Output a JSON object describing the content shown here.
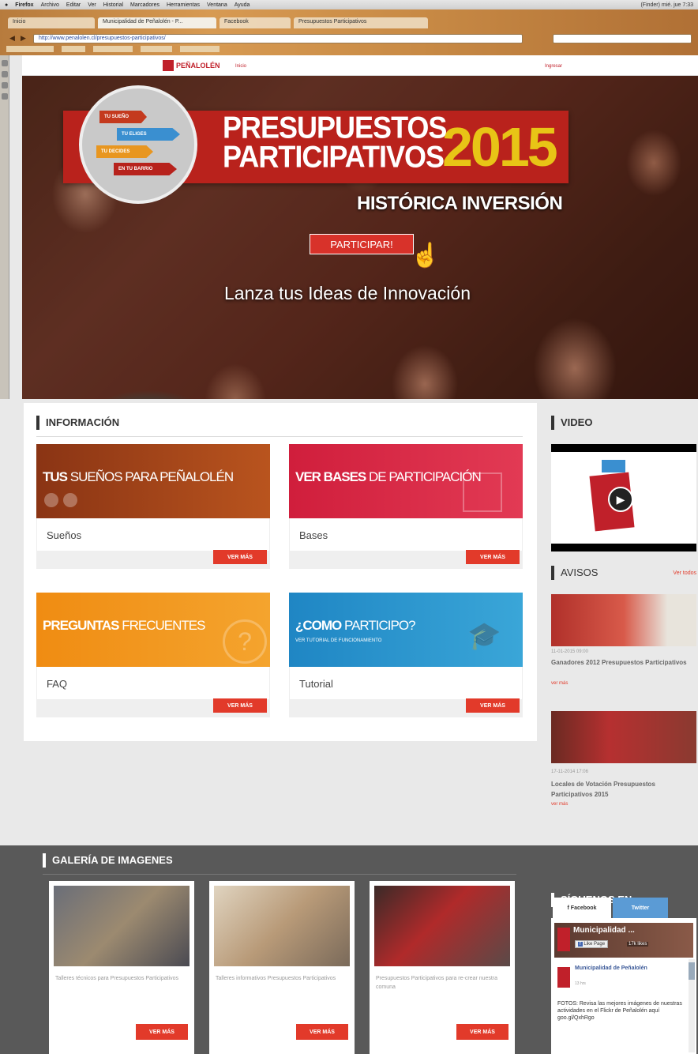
{
  "browser": {
    "menu": [
      "Firefox",
      "Archivo",
      "Editar",
      "Ver",
      "Historial",
      "Marcadores",
      "Herramientas",
      "Ventana",
      "Ayuda"
    ],
    "menu_right": "(Finder) mié. jue 7:33",
    "tabs": [
      "Inicio",
      "Municipalidad de Peñalolén - P...",
      "Facebook",
      "Presupuestos Participativos"
    ],
    "url": "http://www.penalolen.cl/presupuestos-participativos/"
  },
  "site": {
    "logo_text": "PEÑALOLÉN",
    "nav_link": "Inicio",
    "nav_right": "Ingresar"
  },
  "hero": {
    "badge_items": [
      "TU SUEÑO",
      "TU ELIGES",
      "TU DECIDES",
      "EN TU BARRIO"
    ],
    "title_line1": "PRESUPUESTOS",
    "title_line2": "PARTICIPATIVOS",
    "year": "2015",
    "subtitle": "HISTÓRICA INVERSIÓN",
    "button": "PARTICIPAR!",
    "tagline": "Lanza tus Ideas de Innovación"
  },
  "info": {
    "heading": "INFORMACIÓN",
    "cards": [
      {
        "title_bold": "TUS",
        "title_rest": "SUEÑOS PARA PEÑALOLÉN",
        "sub": "",
        "label": "Sueños",
        "button": "VER MÁS",
        "color": "#a8421a"
      },
      {
        "title_bold": "VER BASES",
        "title_rest": "DE PARTICIPACIÓN",
        "sub": "",
        "label": "Bases",
        "button": "VER MÁS",
        "color": "#d8243f"
      },
      {
        "title_bold": "PREGUNTAS",
        "title_rest": "FRECUENTES",
        "sub": "",
        "label": "FAQ",
        "button": "VER MÁS",
        "color": "#f08a1c"
      },
      {
        "title_bold": "¿COMO",
        "title_rest": "PARTICIPO?",
        "sub": "VER TUTORIAL DE FUNCIONAMIENTO",
        "label": "Tutorial",
        "button": "VER MÁS",
        "color": "#2a8fc8"
      }
    ]
  },
  "video": {
    "heading": "VIDEO"
  },
  "avisos": {
    "heading": "AVISOS",
    "link": "Ver todos",
    "items": [
      {
        "date": "11-01-2015 09:00",
        "title": "Ganadores 2012 Presupuestos Participativos",
        "more": "ver más"
      },
      {
        "date": "17-11-2014 17:06",
        "title": "Locales de Votación Presupuestos Participativos 2015",
        "more": "ver más"
      }
    ]
  },
  "gallery": {
    "heading": "GALERÍA DE IMAGENES",
    "items": [
      {
        "caption": "Talleres técnicos para Presupuestos Participativos",
        "button": "VER MÁS"
      },
      {
        "caption": "Talleres informativos Presupuestos Participativos",
        "button": "VER MÁS"
      },
      {
        "caption": "Presupuestos Participativos para re-crear nuestra comuna",
        "button": "VER MÁS"
      }
    ]
  },
  "social": {
    "heading": "SÍGUENOS EN",
    "tab_facebook": "f Facebook",
    "tab_twitter": "Twitter",
    "page_name": "Municipalidad ...",
    "like_button": "Like Page",
    "likes": "17k likes",
    "post_author": "Municipalidad de Peñalolén",
    "post_time": "13 hrs",
    "post_text": "FOTOS: Revisa las mejores imágenes de nuestras actividades en el Flickr de Peñalolén aquí goo.gl/QxhRgo"
  }
}
